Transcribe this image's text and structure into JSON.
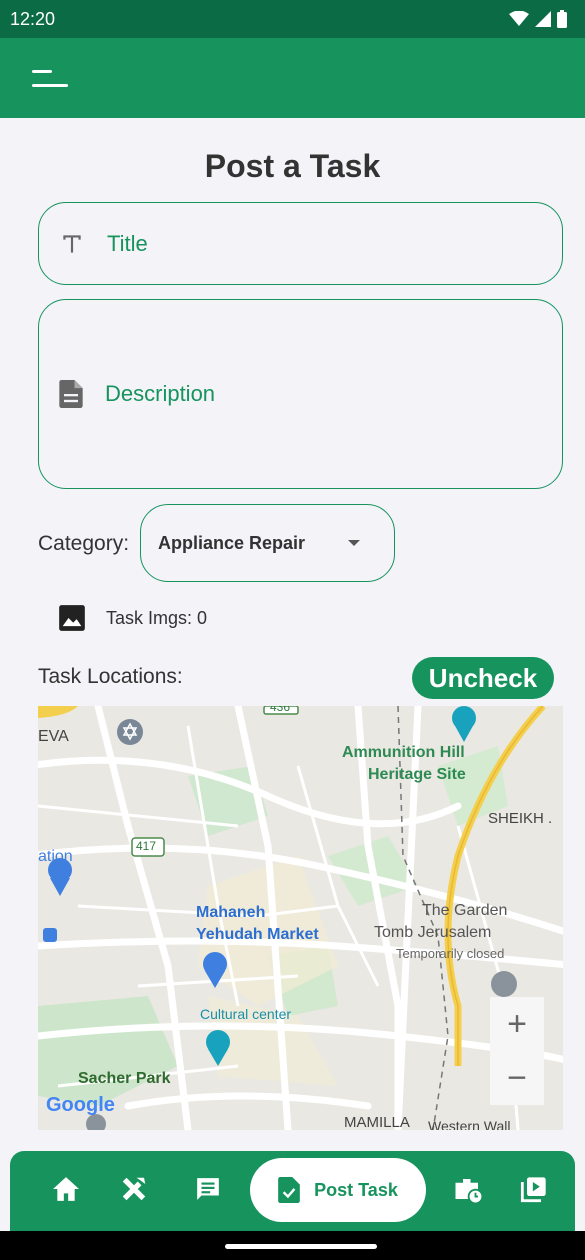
{
  "status_bar": {
    "time": "12:20"
  },
  "page": {
    "title": "Post a Task"
  },
  "form": {
    "title_placeholder": "Title",
    "description_placeholder": "Description",
    "category_label": "Category:",
    "category_value": "Appliance Repair",
    "task_imgs": "Task Imgs: 0",
    "locations_label": "Task Locations:",
    "uncheck_label": "Uncheck"
  },
  "map": {
    "labels": {
      "eva": "EVA",
      "ammunition": "Ammunition Hill",
      "heritage": "Heritage Site",
      "sheikh": "SHEIKH .",
      "ation": "ation",
      "r417": "417",
      "r436": "436",
      "mahaneh": "Mahaneh",
      "yehudah": "Yehudah Market",
      "garden": "The Garden",
      "tomb": "Tomb Jerusalem",
      "closed": "Temporarily closed",
      "cultural": "Cultural center",
      "sacher": "Sacher Park",
      "mamilla": "MAMILLA",
      "western": "Western Wall",
      "google": "Google"
    },
    "zoom_in": "+",
    "zoom_out": "−"
  },
  "nav": {
    "active_label": "Post Task"
  },
  "colors": {
    "primary": "#17935e",
    "status_bar": "#0b6b45",
    "background": "#f3f3f8"
  }
}
